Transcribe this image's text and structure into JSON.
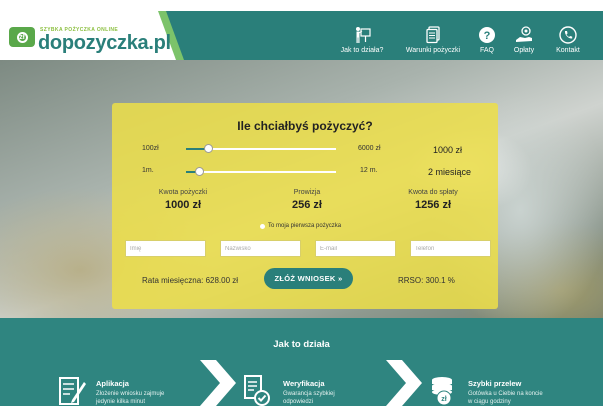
{
  "logo": {
    "tagline": "SZYBKA POŻYCZKA ONLINE",
    "name": "dopozyczka.pl",
    "coin_symbol": "zł"
  },
  "nav": {
    "items": [
      {
        "label": "Jak to działa?",
        "icon": "presentation-icon"
      },
      {
        "label": "Warunki pożyczki",
        "icon": "documents-icon"
      },
      {
        "label": "FAQ",
        "icon": "question-icon"
      },
      {
        "label": "Opłaty",
        "icon": "hand-coin-icon"
      },
      {
        "label": "Kontakt",
        "icon": "phone-icon"
      }
    ]
  },
  "calculator": {
    "title": "Ile chciałbyś pożyczyć?",
    "amount": {
      "min_label": "100zł",
      "max_label": "6000 zł",
      "value_label": "1000 zł",
      "min": 100,
      "max": 6000,
      "value": 1000
    },
    "period": {
      "min_label": "1m.",
      "max_label": "12 m.",
      "value_label": "2 miesiące",
      "min": 1,
      "max": 12,
      "value": 2
    },
    "stats": [
      {
        "label": "Kwota pożyczki",
        "value": "1000 zł"
      },
      {
        "label": "Prowizja",
        "value": "256 zł"
      },
      {
        "label": "Kwota do spłaty",
        "value": "1256 zł"
      }
    ],
    "first_loan_label": "To moja pierwsza pożyczka",
    "fields": [
      {
        "placeholder": "Imię",
        "value": ""
      },
      {
        "placeholder": "Nazwisko",
        "value": ""
      },
      {
        "placeholder": "E-mail",
        "value": ""
      },
      {
        "placeholder": "Telefon",
        "value": ""
      }
    ],
    "monthly_rate": "Rata miesięczna: 628.00 zł",
    "apply_label": "ZŁÓŻ WNIOSEK »",
    "rrso": "RRSO: 300.1 %"
  },
  "how_it_works": {
    "title": "Jak to działa",
    "steps": [
      {
        "title": "Aplikacja",
        "desc": "Złożenie wniosku zajmuje jedynie kilka minut",
        "icon": "form-icon"
      },
      {
        "title": "Weryfikacja",
        "desc": "Gwarancja szybkiej odpowiedzi",
        "icon": "document-check-icon"
      },
      {
        "title": "Szybki przelew",
        "desc": "Gotówka u Ciebie na koncie w ciągu godziny",
        "icon": "coins-icon"
      }
    ]
  },
  "colors": {
    "brand_teal": "#2a7f7a",
    "brand_green": "#7cc36a",
    "panel_yellow": "#ecde48"
  }
}
